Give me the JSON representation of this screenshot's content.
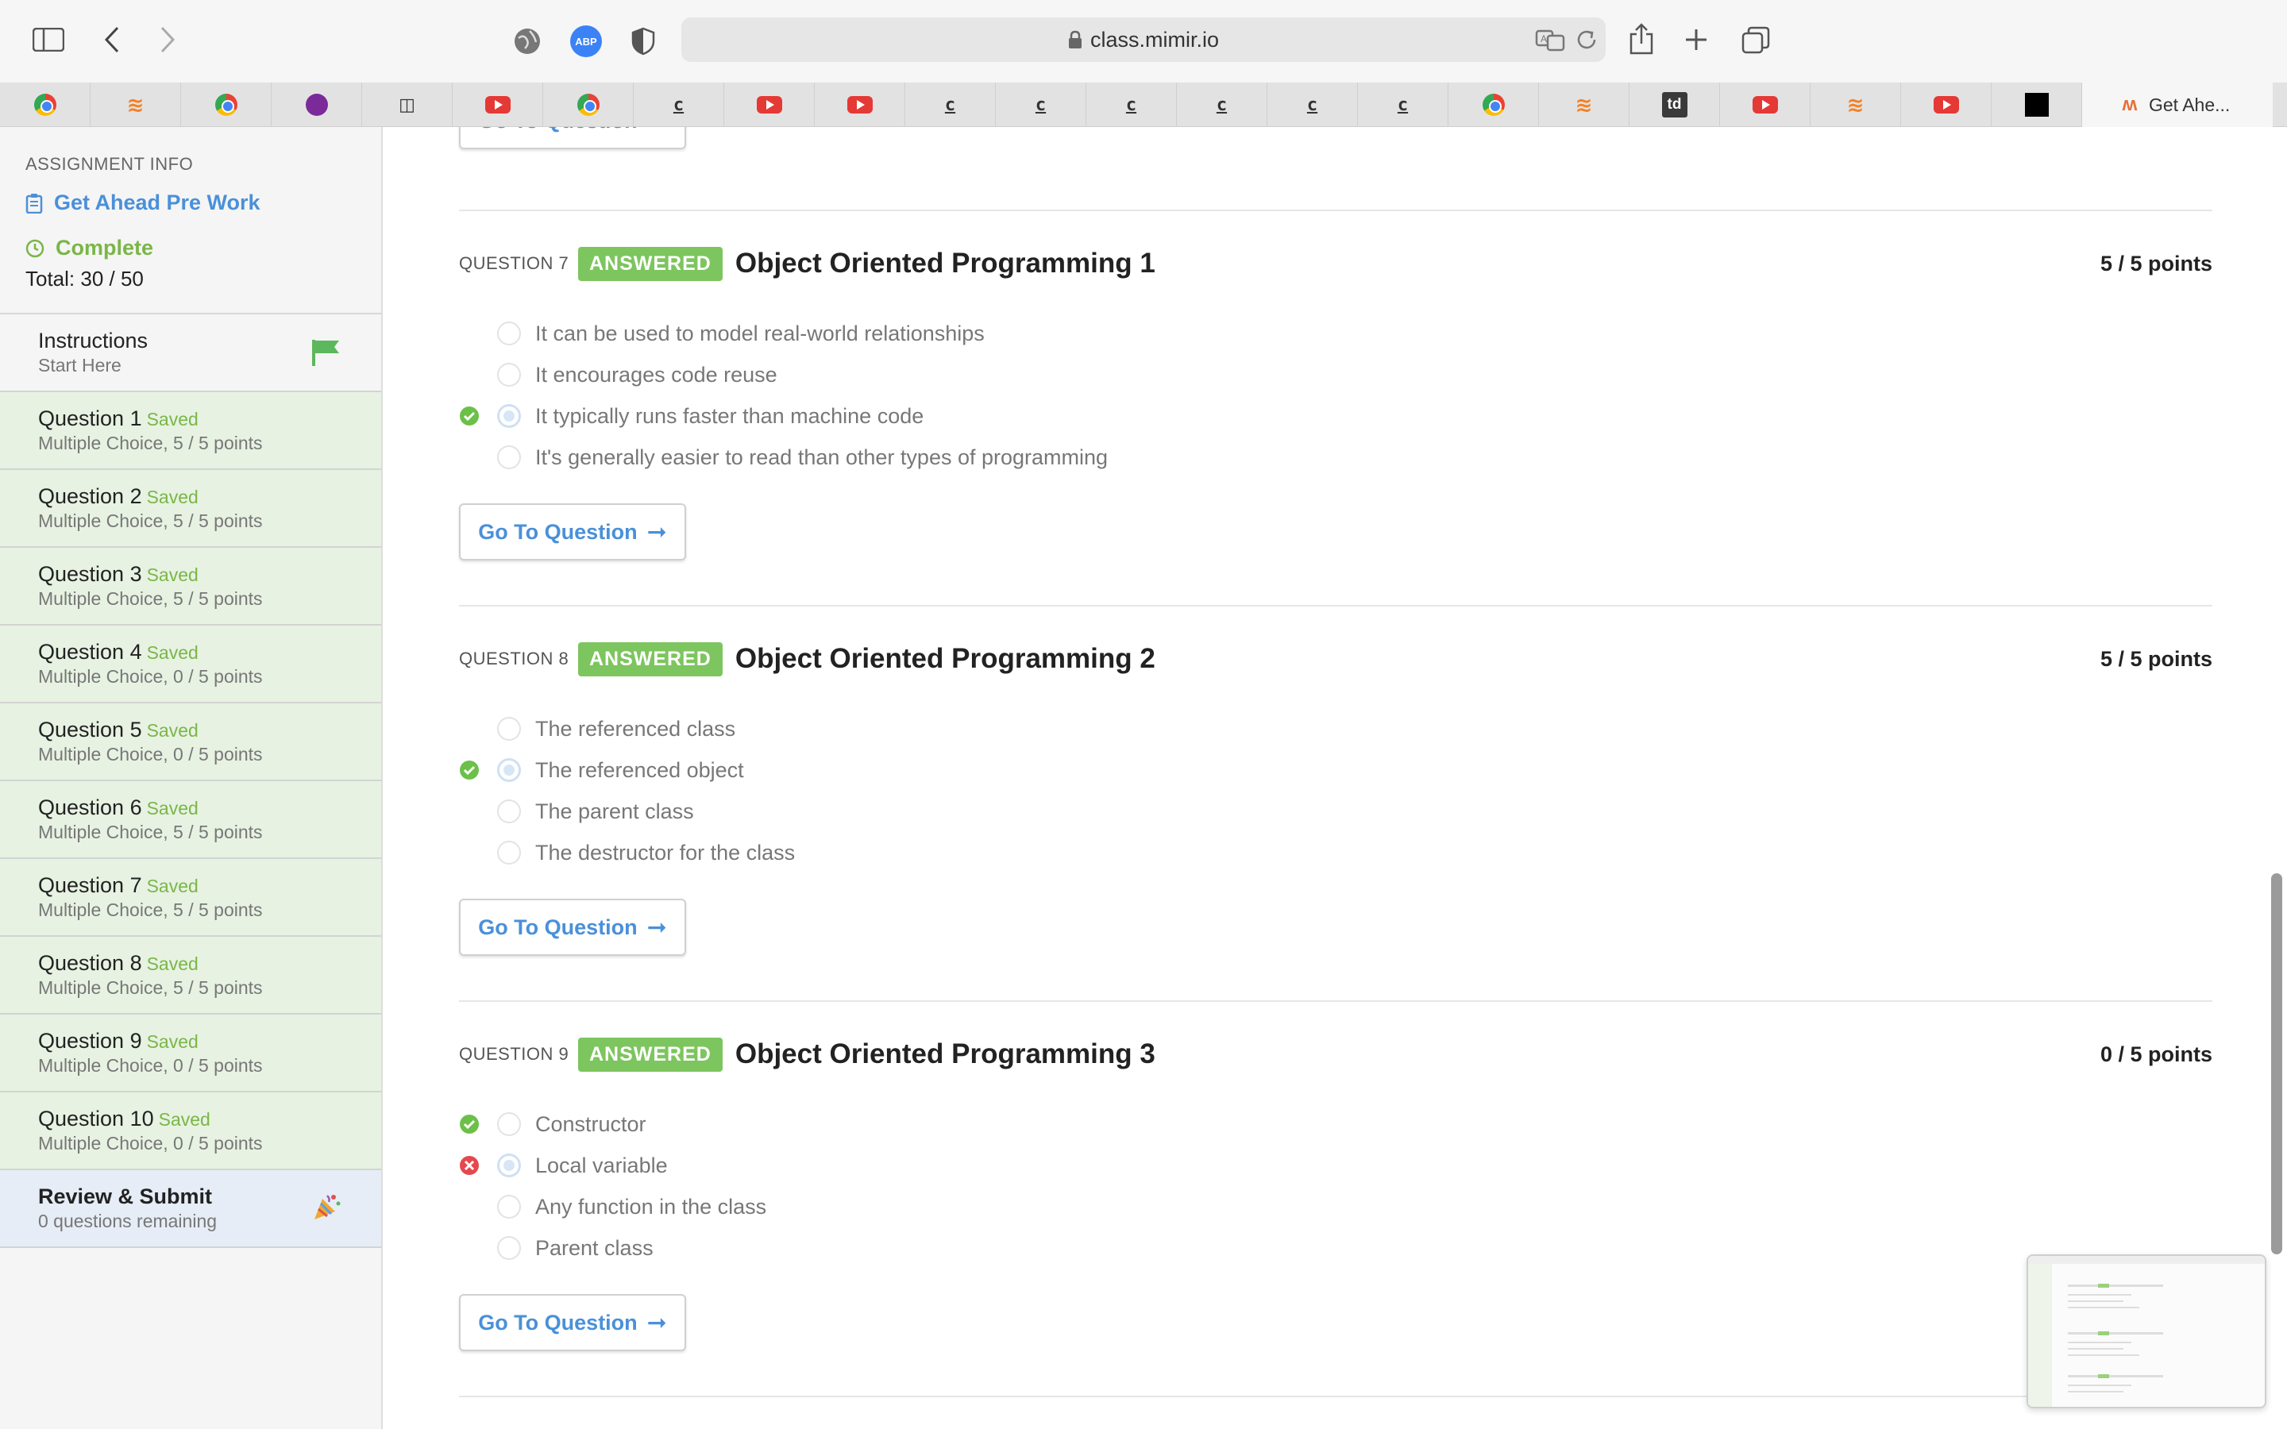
{
  "browser": {
    "url": "class.mimir.io",
    "tabs": [
      {
        "icon": "chrome-icon"
      },
      {
        "icon": "stackoverflow-icon"
      },
      {
        "icon": "chrome-icon"
      },
      {
        "icon": "avatar-icon"
      },
      {
        "icon": "doc-icon"
      },
      {
        "icon": "youtube-icon"
      },
      {
        "icon": "chrome-icon"
      },
      {
        "icon": "codecademy-icon"
      },
      {
        "icon": "youtube-icon"
      },
      {
        "icon": "youtube-icon"
      },
      {
        "icon": "codecademy-icon"
      },
      {
        "icon": "codecademy-icon"
      },
      {
        "icon": "codecademy-icon"
      },
      {
        "icon": "codecademy-icon"
      },
      {
        "icon": "codecademy-icon"
      },
      {
        "icon": "codecademy-icon"
      },
      {
        "icon": "chrome-icon"
      },
      {
        "icon": "stackoverflow-icon"
      },
      {
        "icon": "td-icon"
      },
      {
        "icon": "youtube-icon"
      },
      {
        "icon": "stackoverflow-icon"
      },
      {
        "icon": "youtube-icon"
      },
      {
        "icon": "black-square-icon"
      }
    ],
    "active_tab_label": "Get Ahe...",
    "codecademy_glyph": "c",
    "td_glyph": "td",
    "abp_label": "ABP"
  },
  "sidebar": {
    "info_label": "ASSIGNMENT INFO",
    "assignment_name": "Get Ahead Pre Work",
    "status": "Complete",
    "total": "Total: 30 / 50",
    "instructions": {
      "title": "Instructions",
      "subtitle": "Start Here"
    },
    "questions": [
      {
        "title": "Question 1",
        "saved": "Saved",
        "sub": "Multiple Choice, 5 / 5 points"
      },
      {
        "title": "Question 2",
        "saved": "Saved",
        "sub": "Multiple Choice, 5 / 5 points"
      },
      {
        "title": "Question 3",
        "saved": "Saved",
        "sub": "Multiple Choice, 5 / 5 points"
      },
      {
        "title": "Question 4",
        "saved": "Saved",
        "sub": "Multiple Choice, 0 / 5 points"
      },
      {
        "title": "Question 5",
        "saved": "Saved",
        "sub": "Multiple Choice, 0 / 5 points"
      },
      {
        "title": "Question 6",
        "saved": "Saved",
        "sub": "Multiple Choice, 5 / 5 points"
      },
      {
        "title": "Question 7",
        "saved": "Saved",
        "sub": "Multiple Choice, 5 / 5 points"
      },
      {
        "title": "Question 8",
        "saved": "Saved",
        "sub": "Multiple Choice, 5 / 5 points"
      },
      {
        "title": "Question 9",
        "saved": "Saved",
        "sub": "Multiple Choice, 0 / 5 points"
      },
      {
        "title": "Question 10",
        "saved": "Saved",
        "sub": "Multiple Choice, 0 / 5 points"
      }
    ],
    "review": {
      "title": "Review & Submit",
      "subtitle": "0 questions remaining"
    }
  },
  "main": {
    "goto_label": "Go To Question",
    "sections": [
      {
        "number": "QUESTION 7",
        "badge": "ANSWERED",
        "title": "Object Oriented Programming 1",
        "points": "5 / 5 points",
        "choices": [
          {
            "text": "It can be used to model real-world relationships",
            "selected": false,
            "mark": ""
          },
          {
            "text": "It encourages code reuse",
            "selected": false,
            "mark": ""
          },
          {
            "text": "It typically runs faster than machine code",
            "selected": true,
            "mark": "correct"
          },
          {
            "text": "It's generally easier to read than other types of programming",
            "selected": false,
            "mark": ""
          }
        ]
      },
      {
        "number": "QUESTION 8",
        "badge": "ANSWERED",
        "title": "Object Oriented Programming 2",
        "points": "5 / 5 points",
        "choices": [
          {
            "text": "The referenced class",
            "selected": false,
            "mark": ""
          },
          {
            "text": "The referenced object",
            "selected": true,
            "mark": "correct"
          },
          {
            "text": "The parent class",
            "selected": false,
            "mark": ""
          },
          {
            "text": "The destructor for the class",
            "selected": false,
            "mark": ""
          }
        ]
      },
      {
        "number": "QUESTION 9",
        "badge": "ANSWERED",
        "title": "Object Oriented Programming 3",
        "points": "0 / 5 points",
        "choices": [
          {
            "text": "Constructor",
            "selected": false,
            "mark": "correct"
          },
          {
            "text": "Local variable",
            "selected": true,
            "mark": "incorrect"
          },
          {
            "text": "Any function in the class",
            "selected": false,
            "mark": ""
          },
          {
            "text": "Parent class",
            "selected": false,
            "mark": ""
          }
        ]
      }
    ]
  },
  "colors": {
    "accent_blue": "#4a90d9",
    "answered_green": "#7dc55e",
    "saved_green": "#7ab648",
    "incorrect_red": "#e5484d"
  }
}
